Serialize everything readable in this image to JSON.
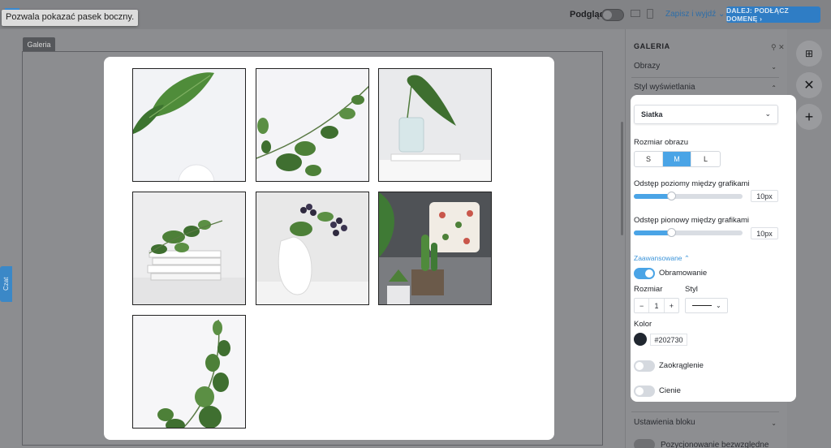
{
  "topbar": {
    "tooltip": "Pozwala pokazać pasek boczny.",
    "preview_label": "Podgląd",
    "save_exit": "Zapisz i wyjdź ⌄",
    "next_button": "DALEJ: PODŁĄCZ DOMENĘ ›"
  },
  "canvas": {
    "gallery_tab": "Galeria",
    "chat_tab": "Czat"
  },
  "gallery": {
    "images": [
      {
        "name": "leaf-white-bg"
      },
      {
        "name": "eucalyptus-branch"
      },
      {
        "name": "leaf-in-vase"
      },
      {
        "name": "books-with-plant"
      },
      {
        "name": "berries-in-vase"
      },
      {
        "name": "cactus-and-pillow"
      },
      {
        "name": "eucalyptus-sprig"
      }
    ]
  },
  "panel": {
    "title": "GALERIA",
    "images_section": "Obrazy",
    "display_style_section": "Styl wyświetlania",
    "block_settings_section": "Ustawienia bloku",
    "absolute_positioning": "Pozycjonowanie bezwzględne"
  },
  "settings": {
    "layout_select": "Siatka",
    "image_size_label": "Rozmiar obrazu",
    "sizes": [
      "S",
      "M",
      "L"
    ],
    "active_size": "M",
    "h_gap_label": "Odstęp poziomy między grafikami",
    "h_gap_value": "10px",
    "v_gap_label": "Odstęp pionowy między grafikami",
    "v_gap_value": "10px",
    "advanced_label": "Zaawansowane ⌃",
    "border_label": "Obramowanie",
    "border_on": true,
    "size_label": "Rozmiar",
    "size_value": "1",
    "style_label": "Styl",
    "color_label": "Kolor",
    "color_value": "#202730",
    "rounding_label": "Zaokrąglenie",
    "shadows_label": "Cienie"
  },
  "colors": {
    "accent": "#4aa4e6",
    "border_color": "#202730"
  }
}
